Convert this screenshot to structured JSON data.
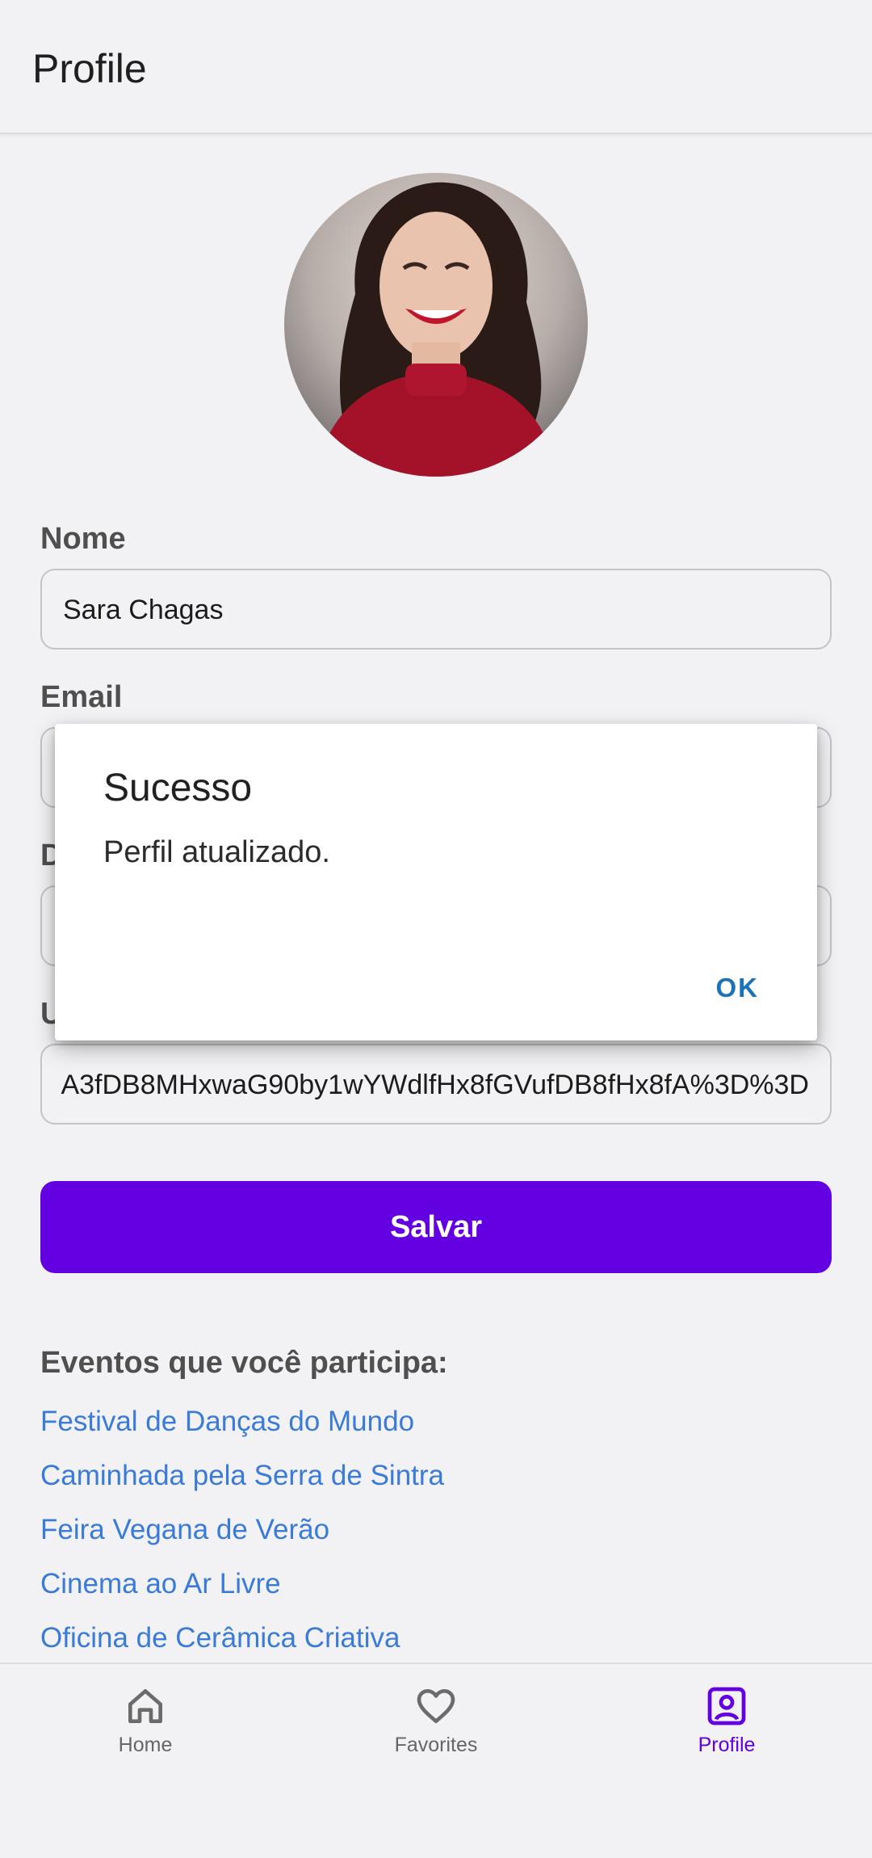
{
  "app_bar": {
    "title": "Profile"
  },
  "form": {
    "name_label": "Nome",
    "name_value": "Sara Chagas",
    "email_label": "Email",
    "description_label_partial": "D",
    "url_label_partial": "U",
    "url_value_visible": "A3fDB8MHxwaG90by1wYWdlfHx8fGVufDB8fHx8fA%3D%3D"
  },
  "save_button": {
    "label": "Salvar"
  },
  "events": {
    "title": "Eventos que você participa:",
    "items": [
      "Festival de Danças do Mundo",
      "Caminhada pela Serra de Sintra",
      "Feira Vegana de Verão",
      "Cinema ao Ar Livre",
      "Oficina de Cerâmica Criativa"
    ]
  },
  "dialog": {
    "title": "Sucesso",
    "message": "Perfil atualizado.",
    "ok_label": "OK"
  },
  "bottom_nav": {
    "items": [
      {
        "label": "Home",
        "icon": "home-icon"
      },
      {
        "label": "Favorites",
        "icon": "heart-icon"
      },
      {
        "label": "Profile",
        "icon": "profile-icon",
        "active": true
      }
    ]
  },
  "colors": {
    "accent": "#6200e2",
    "link": "#3a7bd9",
    "dialog_action": "#1a73b8",
    "background": "#f2f2f4"
  }
}
